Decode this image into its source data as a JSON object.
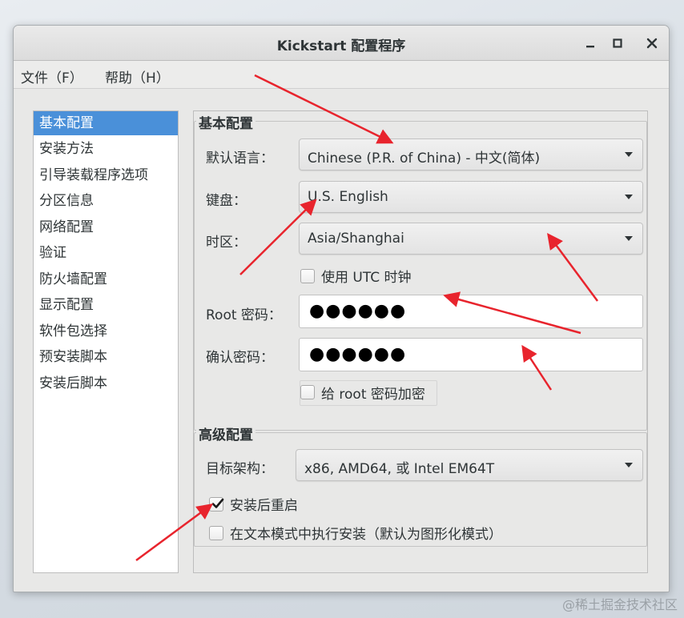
{
  "window": {
    "title": "Kickstart 配置程序",
    "controls": [
      "minimize-icon",
      "maximize-icon",
      "close-icon"
    ]
  },
  "menubar": {
    "file": "文件（F）",
    "help": "帮助（H）"
  },
  "sidebar": {
    "items": [
      {
        "label": "基本配置",
        "selected": true
      },
      {
        "label": "安装方法",
        "selected": false
      },
      {
        "label": "引导装载程序选项",
        "selected": false
      },
      {
        "label": "分区信息",
        "selected": false
      },
      {
        "label": "网络配置",
        "selected": false
      },
      {
        "label": "验证",
        "selected": false
      },
      {
        "label": "防火墙配置",
        "selected": false
      },
      {
        "label": "显示配置",
        "selected": false
      },
      {
        "label": "软件包选择",
        "selected": false
      },
      {
        "label": "预安装脚本",
        "selected": false
      },
      {
        "label": "安装后脚本",
        "selected": false
      }
    ]
  },
  "basic": {
    "section_title": "基本配置",
    "language_label": "默认语言：",
    "language_value": "Chinese (P.R. of China) - 中文(简体)",
    "keyboard_label": "键盘：",
    "keyboard_value": "U.S. English",
    "timezone_label": "时区：",
    "timezone_value": "Asia/Shanghai",
    "utc_label": "使用  UTC 时钟",
    "utc_checked": false,
    "root_password_label": "Root 密码：",
    "root_password_value": "●●●●●●",
    "confirm_password_label": "确认密码：",
    "confirm_password_value": "●●●●●●",
    "encrypt_label": "给  root 密码加密",
    "encrypt_checked": false
  },
  "advanced": {
    "section_title": "高级配置",
    "arch_label": "目标架构：",
    "arch_value": "x86, AMD64, 或  Intel EM64T",
    "reboot_label": "安装后重启",
    "reboot_checked": true,
    "text_mode_label": "在文本模式中执行安装（默认为图形化模式）",
    "text_mode_checked": false
  },
  "watermark": "@稀土掘金技术社区",
  "colors": {
    "selection": "#4a90d9",
    "annotation_arrow": "#e8242d"
  }
}
